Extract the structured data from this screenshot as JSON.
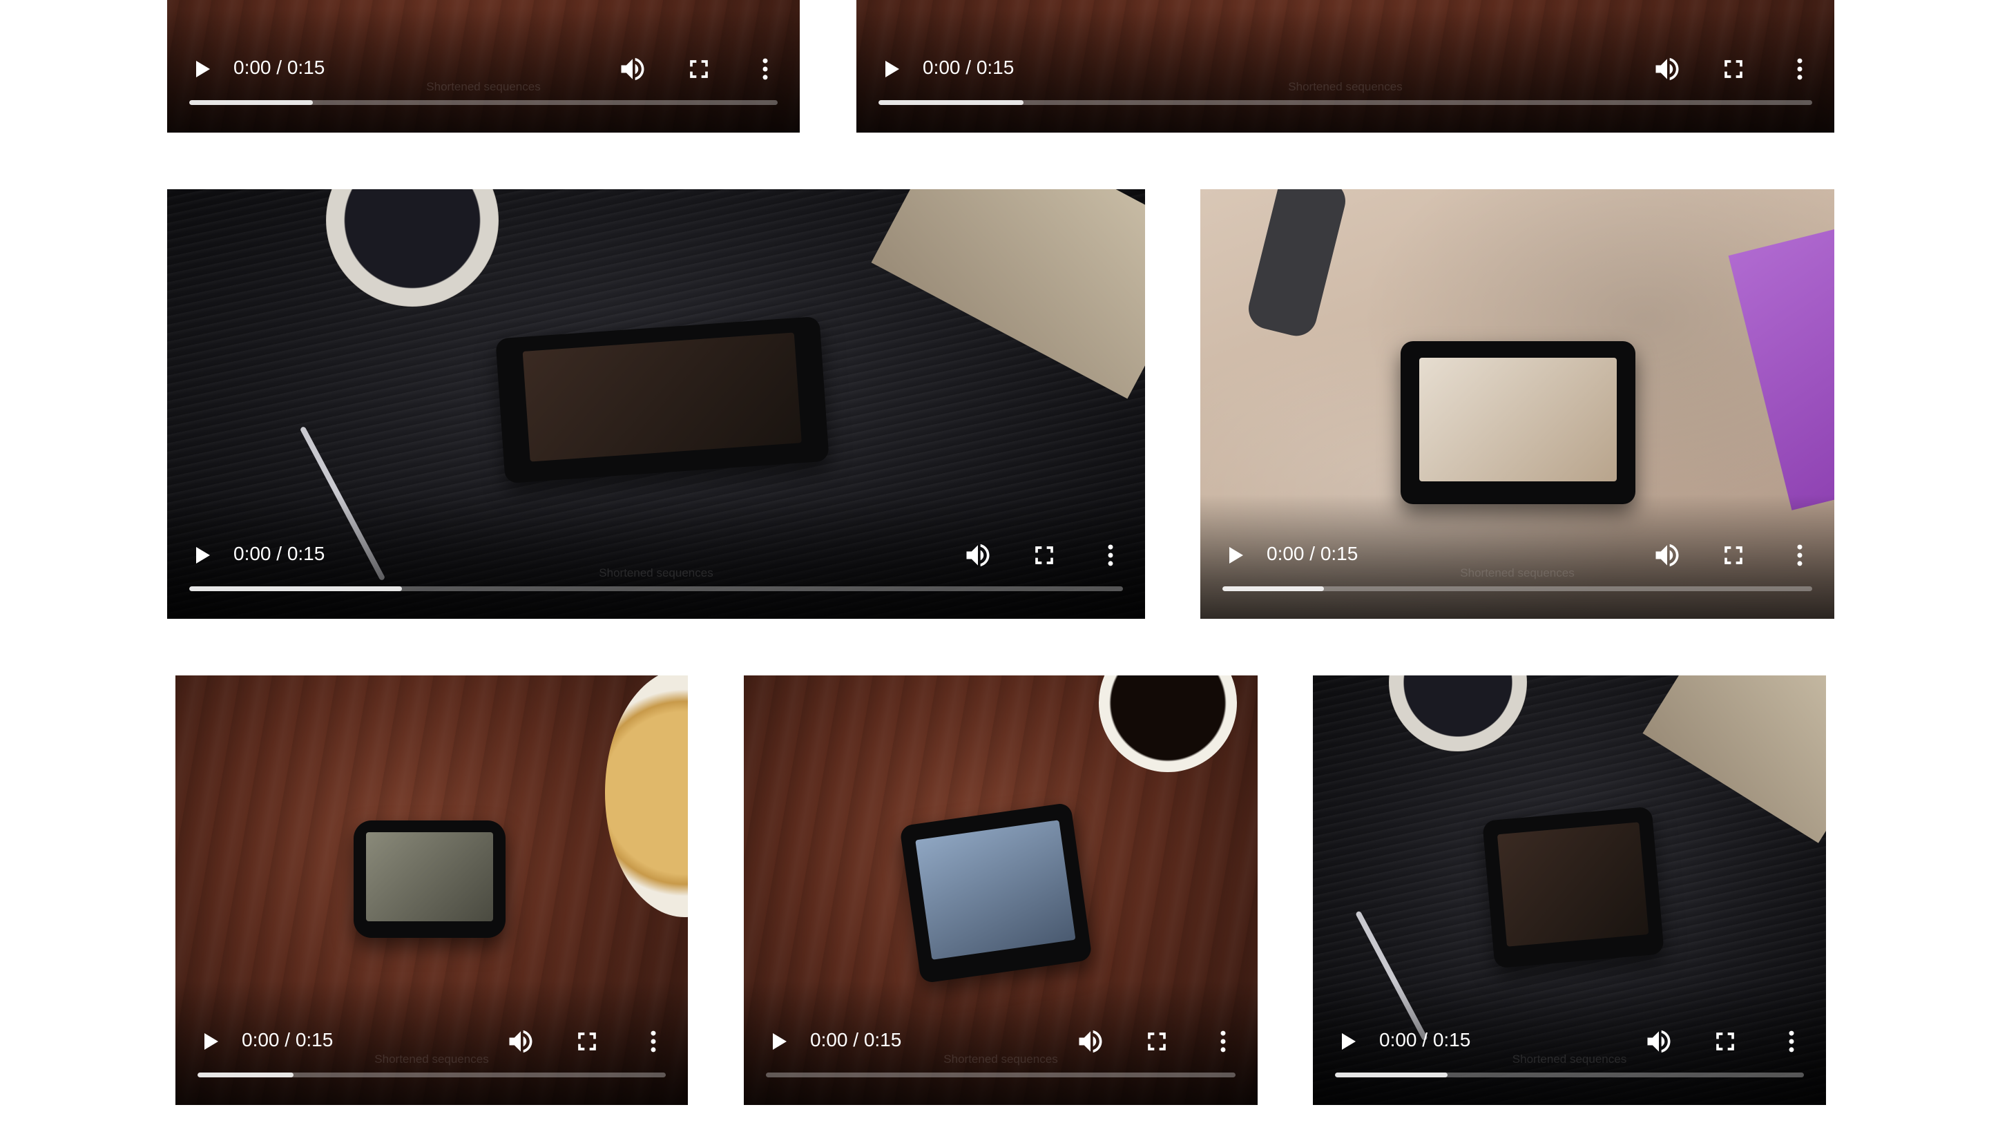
{
  "videos": [
    {
      "id": "v1",
      "time": "0:00 / 0:15",
      "caption": "Shortened sequences",
      "buffered": 0.21
    },
    {
      "id": "v2",
      "time": "0:00 / 0:15",
      "caption": "Shortened sequences",
      "buffered": 0.155
    },
    {
      "id": "v3",
      "time": "0:00 / 0:15",
      "caption": "Shortened sequences",
      "buffered": 0.228
    },
    {
      "id": "v4",
      "time": "0:00 / 0:15",
      "caption": "Shortened sequences",
      "buffered": 0.172
    },
    {
      "id": "v5",
      "time": "0:00 / 0:15",
      "caption": "Shortened sequences",
      "buffered": 0.205
    },
    {
      "id": "v6",
      "time": "0:00 / 0:15",
      "caption": "Shortened sequences",
      "buffered": 0.0
    },
    {
      "id": "v7",
      "time": "0:00 / 0:15",
      "caption": "Shortened sequences",
      "buffered": 0.24
    }
  ],
  "icons": {
    "play": "play-icon",
    "volume": "volume-icon",
    "fullscreen": "fullscreen-icon",
    "more": "more-options-icon"
  }
}
